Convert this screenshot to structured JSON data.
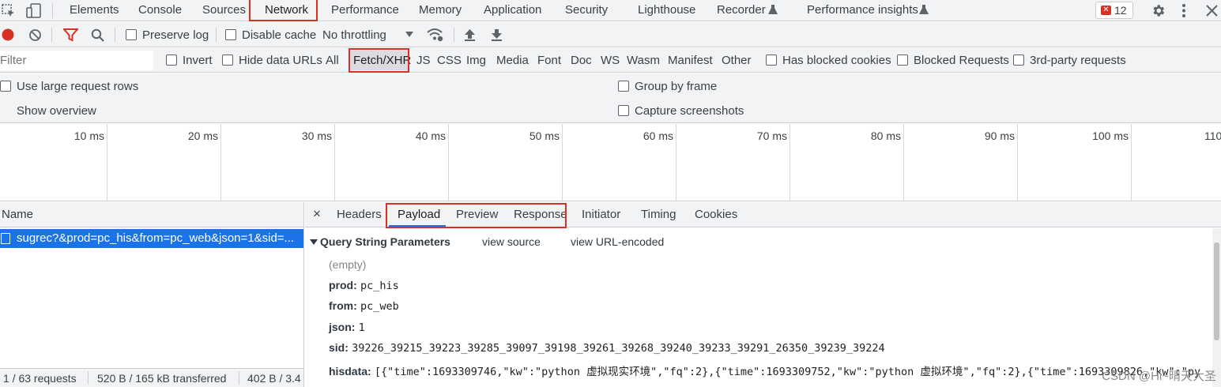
{
  "tabs": [
    "Elements",
    "Console",
    "Sources",
    "Network",
    "Performance",
    "Memory",
    "Application",
    "Security",
    "Lighthouse",
    "Recorder",
    "Performance insights"
  ],
  "issues_count": "12",
  "toolbar": {
    "preserve_log": "Preserve log",
    "disable_cache": "Disable cache",
    "throttling": "No throttling"
  },
  "filter": {
    "placeholder": "Filter",
    "invert": "Invert",
    "hide_data_urls": "Hide data URLs",
    "types": [
      "All",
      "Fetch/XHR",
      "JS",
      "CSS",
      "Img",
      "Media",
      "Font",
      "Doc",
      "WS",
      "Wasm",
      "Manifest",
      "Other"
    ],
    "has_blocked_cookies": "Has blocked cookies",
    "blocked_requests": "Blocked Requests",
    "third_party": "3rd-party requests"
  },
  "settings": {
    "large_rows": "Use large request rows",
    "group_by_frame": "Group by frame",
    "show_overview": "Show overview",
    "capture_screenshots": "Capture screenshots"
  },
  "overview_ticks": [
    "10 ms",
    "20 ms",
    "30 ms",
    "40 ms",
    "50 ms",
    "60 ms",
    "70 ms",
    "80 ms",
    "90 ms",
    "100 ms",
    "110"
  ],
  "requests": {
    "column_name": "Name",
    "selected": "sugrec?&prod=pc_his&from=pc_web&json=1&sid=...",
    "status": "1 / 63 requests",
    "transferred": "520 B / 165 kB transferred",
    "resources": "402 B / 3.4"
  },
  "detail_tabs": {
    "close": "×",
    "headers": "Headers",
    "payload": "Payload",
    "preview": "Preview",
    "response": "Response",
    "initiator": "Initiator",
    "timing": "Timing",
    "cookies": "Cookies"
  },
  "payload": {
    "section_title": "Query String Parameters",
    "view_source": "view source",
    "view_url_encoded": "view URL-encoded",
    "empty": "(empty)",
    "params": [
      {
        "key": "prod:",
        "value": "pc_his"
      },
      {
        "key": "from:",
        "value": "pc_web"
      },
      {
        "key": "json:",
        "value": "1"
      },
      {
        "key": "sid:",
        "value": "39226_39215_39223_39285_39097_39198_39261_39268_39240_39233_39291_26350_39239_39224"
      },
      {
        "key": "hisdata:",
        "value": "[{\"time\":1693309746,\"kw\":\"python 虚拟现实环境\",\"fq\":2},{\"time\":1693309752,\"kw\":\"python 虚拟环境\",\"fq\":2},{\"time\":1693309826,\"kw\":\"py"
      }
    ]
  },
  "watermark": "CSDN @Hi~晴天大圣"
}
